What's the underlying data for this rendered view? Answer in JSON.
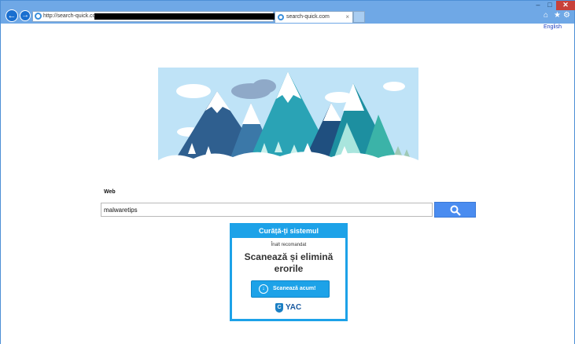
{
  "browser": {
    "address_url": "http://search-quick.com",
    "tab_title": "search-quick.com",
    "tab_close": "×",
    "window_min": "–",
    "window_max": "□",
    "window_close": "✕",
    "addr_search_glyph": "⌕",
    "addr_dropdown_glyph": "▾",
    "addr_refresh_glyph": "↻"
  },
  "page": {
    "language_link": "English",
    "web_label": "Web",
    "search_value": "malwaretips"
  },
  "ad": {
    "title": "Curăță-ți sistemul",
    "subtitle": "Înalt recomandat",
    "headline_line1": "Scanează și elimină",
    "headline_line2": "erorile",
    "button_label": "Scanează acum!",
    "logo_mark": "C",
    "logo_text": "YAC"
  },
  "colors": {
    "titlebar": "#6fa8e6",
    "ad_accent": "#1da2e8",
    "search_button": "#4a8cf0",
    "close_button": "#c8413a"
  },
  "icons": {
    "back": "back-arrow-icon",
    "forward": "forward-arrow-icon",
    "home": "home-icon",
    "favorites": "star-icon",
    "settings": "gear-icon",
    "search": "magnifier-icon"
  }
}
